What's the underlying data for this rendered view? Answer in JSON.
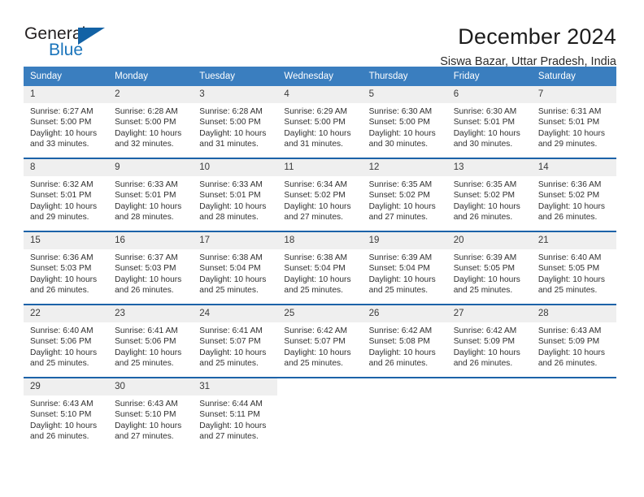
{
  "brand": {
    "word_general": "General",
    "word_blue": "Blue",
    "triangle_color": "#1362a5"
  },
  "header": {
    "title": "December 2024",
    "location": "Siswa Bazar, Uttar Pradesh, India"
  },
  "theme": {
    "header_row_bg": "#3a7ebf",
    "week_divider": "#1c63a8",
    "daynum_bg": "#efefef",
    "text": "#303030"
  },
  "weekdays": [
    "Sunday",
    "Monday",
    "Tuesday",
    "Wednesday",
    "Thursday",
    "Friday",
    "Saturday"
  ],
  "weeks": [
    [
      {
        "day": "1",
        "sunrise": "Sunrise: 6:27 AM",
        "sunset": "Sunset: 5:00 PM",
        "daylight1": "Daylight: 10 hours",
        "daylight2": "and 33 minutes."
      },
      {
        "day": "2",
        "sunrise": "Sunrise: 6:28 AM",
        "sunset": "Sunset: 5:00 PM",
        "daylight1": "Daylight: 10 hours",
        "daylight2": "and 32 minutes."
      },
      {
        "day": "3",
        "sunrise": "Sunrise: 6:28 AM",
        "sunset": "Sunset: 5:00 PM",
        "daylight1": "Daylight: 10 hours",
        "daylight2": "and 31 minutes."
      },
      {
        "day": "4",
        "sunrise": "Sunrise: 6:29 AM",
        "sunset": "Sunset: 5:00 PM",
        "daylight1": "Daylight: 10 hours",
        "daylight2": "and 31 minutes."
      },
      {
        "day": "5",
        "sunrise": "Sunrise: 6:30 AM",
        "sunset": "Sunset: 5:00 PM",
        "daylight1": "Daylight: 10 hours",
        "daylight2": "and 30 minutes."
      },
      {
        "day": "6",
        "sunrise": "Sunrise: 6:30 AM",
        "sunset": "Sunset: 5:01 PM",
        "daylight1": "Daylight: 10 hours",
        "daylight2": "and 30 minutes."
      },
      {
        "day": "7",
        "sunrise": "Sunrise: 6:31 AM",
        "sunset": "Sunset: 5:01 PM",
        "daylight1": "Daylight: 10 hours",
        "daylight2": "and 29 minutes."
      }
    ],
    [
      {
        "day": "8",
        "sunrise": "Sunrise: 6:32 AM",
        "sunset": "Sunset: 5:01 PM",
        "daylight1": "Daylight: 10 hours",
        "daylight2": "and 29 minutes."
      },
      {
        "day": "9",
        "sunrise": "Sunrise: 6:33 AM",
        "sunset": "Sunset: 5:01 PM",
        "daylight1": "Daylight: 10 hours",
        "daylight2": "and 28 minutes."
      },
      {
        "day": "10",
        "sunrise": "Sunrise: 6:33 AM",
        "sunset": "Sunset: 5:01 PM",
        "daylight1": "Daylight: 10 hours",
        "daylight2": "and 28 minutes."
      },
      {
        "day": "11",
        "sunrise": "Sunrise: 6:34 AM",
        "sunset": "Sunset: 5:02 PM",
        "daylight1": "Daylight: 10 hours",
        "daylight2": "and 27 minutes."
      },
      {
        "day": "12",
        "sunrise": "Sunrise: 6:35 AM",
        "sunset": "Sunset: 5:02 PM",
        "daylight1": "Daylight: 10 hours",
        "daylight2": "and 27 minutes."
      },
      {
        "day": "13",
        "sunrise": "Sunrise: 6:35 AM",
        "sunset": "Sunset: 5:02 PM",
        "daylight1": "Daylight: 10 hours",
        "daylight2": "and 26 minutes."
      },
      {
        "day": "14",
        "sunrise": "Sunrise: 6:36 AM",
        "sunset": "Sunset: 5:02 PM",
        "daylight1": "Daylight: 10 hours",
        "daylight2": "and 26 minutes."
      }
    ],
    [
      {
        "day": "15",
        "sunrise": "Sunrise: 6:36 AM",
        "sunset": "Sunset: 5:03 PM",
        "daylight1": "Daylight: 10 hours",
        "daylight2": "and 26 minutes."
      },
      {
        "day": "16",
        "sunrise": "Sunrise: 6:37 AM",
        "sunset": "Sunset: 5:03 PM",
        "daylight1": "Daylight: 10 hours",
        "daylight2": "and 26 minutes."
      },
      {
        "day": "17",
        "sunrise": "Sunrise: 6:38 AM",
        "sunset": "Sunset: 5:04 PM",
        "daylight1": "Daylight: 10 hours",
        "daylight2": "and 25 minutes."
      },
      {
        "day": "18",
        "sunrise": "Sunrise: 6:38 AM",
        "sunset": "Sunset: 5:04 PM",
        "daylight1": "Daylight: 10 hours",
        "daylight2": "and 25 minutes."
      },
      {
        "day": "19",
        "sunrise": "Sunrise: 6:39 AM",
        "sunset": "Sunset: 5:04 PM",
        "daylight1": "Daylight: 10 hours",
        "daylight2": "and 25 minutes."
      },
      {
        "day": "20",
        "sunrise": "Sunrise: 6:39 AM",
        "sunset": "Sunset: 5:05 PM",
        "daylight1": "Daylight: 10 hours",
        "daylight2": "and 25 minutes."
      },
      {
        "day": "21",
        "sunrise": "Sunrise: 6:40 AM",
        "sunset": "Sunset: 5:05 PM",
        "daylight1": "Daylight: 10 hours",
        "daylight2": "and 25 minutes."
      }
    ],
    [
      {
        "day": "22",
        "sunrise": "Sunrise: 6:40 AM",
        "sunset": "Sunset: 5:06 PM",
        "daylight1": "Daylight: 10 hours",
        "daylight2": "and 25 minutes."
      },
      {
        "day": "23",
        "sunrise": "Sunrise: 6:41 AM",
        "sunset": "Sunset: 5:06 PM",
        "daylight1": "Daylight: 10 hours",
        "daylight2": "and 25 minutes."
      },
      {
        "day": "24",
        "sunrise": "Sunrise: 6:41 AM",
        "sunset": "Sunset: 5:07 PM",
        "daylight1": "Daylight: 10 hours",
        "daylight2": "and 25 minutes."
      },
      {
        "day": "25",
        "sunrise": "Sunrise: 6:42 AM",
        "sunset": "Sunset: 5:07 PM",
        "daylight1": "Daylight: 10 hours",
        "daylight2": "and 25 minutes."
      },
      {
        "day": "26",
        "sunrise": "Sunrise: 6:42 AM",
        "sunset": "Sunset: 5:08 PM",
        "daylight1": "Daylight: 10 hours",
        "daylight2": "and 26 minutes."
      },
      {
        "day": "27",
        "sunrise": "Sunrise: 6:42 AM",
        "sunset": "Sunset: 5:09 PM",
        "daylight1": "Daylight: 10 hours",
        "daylight2": "and 26 minutes."
      },
      {
        "day": "28",
        "sunrise": "Sunrise: 6:43 AM",
        "sunset": "Sunset: 5:09 PM",
        "daylight1": "Daylight: 10 hours",
        "daylight2": "and 26 minutes."
      }
    ],
    [
      {
        "day": "29",
        "sunrise": "Sunrise: 6:43 AM",
        "sunset": "Sunset: 5:10 PM",
        "daylight1": "Daylight: 10 hours",
        "daylight2": "and 26 minutes."
      },
      {
        "day": "30",
        "sunrise": "Sunrise: 6:43 AM",
        "sunset": "Sunset: 5:10 PM",
        "daylight1": "Daylight: 10 hours",
        "daylight2": "and 27 minutes."
      },
      {
        "day": "31",
        "sunrise": "Sunrise: 6:44 AM",
        "sunset": "Sunset: 5:11 PM",
        "daylight1": "Daylight: 10 hours",
        "daylight2": "and 27 minutes."
      },
      {
        "day": "",
        "sunrise": "",
        "sunset": "",
        "daylight1": "",
        "daylight2": "",
        "blank": true
      },
      {
        "day": "",
        "sunrise": "",
        "sunset": "",
        "daylight1": "",
        "daylight2": "",
        "blank": true
      },
      {
        "day": "",
        "sunrise": "",
        "sunset": "",
        "daylight1": "",
        "daylight2": "",
        "blank": true
      },
      {
        "day": "",
        "sunrise": "",
        "sunset": "",
        "daylight1": "",
        "daylight2": "",
        "blank": true
      }
    ]
  ]
}
